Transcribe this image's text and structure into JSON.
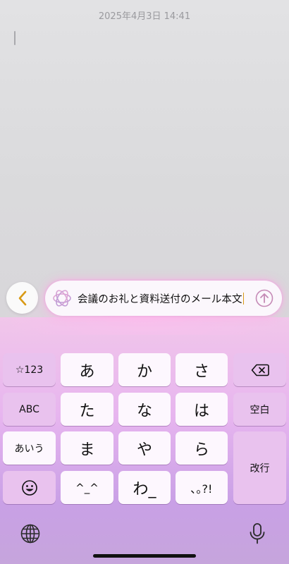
{
  "note": {
    "timestamp": "2025年4月3日 14:41"
  },
  "writing_tools": {
    "prompt_text": "会議のお礼と資料送付のメール本文",
    "back_icon": "chevron-left-icon",
    "assistant_icon": "apple-intelligence-icon",
    "send_icon": "arrow-up-circle-icon",
    "accent_color": "#d99a15"
  },
  "keyboard": {
    "row1": [
      "☆123",
      "あ",
      "か",
      "さ"
    ],
    "row2": [
      "ABC",
      "た",
      "な",
      "は",
      "空白"
    ],
    "row3": [
      "あいう",
      "ま",
      "や",
      "ら"
    ],
    "row4": [
      "^_^",
      "わ_",
      "､｡?!"
    ],
    "enter_label": "改行",
    "delete_icon": "delete-backward-icon",
    "emoji_icon": "emoji-icon",
    "globe_icon": "globe-icon",
    "mic_icon": "microphone-icon"
  }
}
